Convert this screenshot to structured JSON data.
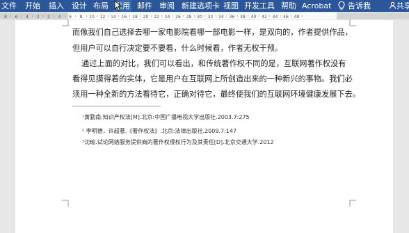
{
  "ribbon": {
    "tabs": [
      "文件",
      "开始",
      "插入",
      "设计",
      "布局",
      "引用",
      "邮件",
      "审阅",
      "新建选项卡",
      "视图",
      "开发工具",
      "帮助",
      "Acrobat"
    ],
    "tell_me": "告诉我",
    "share": "共享",
    "colors": {
      "ribbon_bg": "#2b579a",
      "active_tab": "#3b67aa"
    },
    "icons": [
      "lightbulb-icon",
      "share-icon",
      "mouse-cursor-icon"
    ]
  },
  "ruler": {
    "labels": [
      "8",
      "6",
      "4",
      "2",
      "2",
      "4",
      "6",
      "8",
      "10",
      "12",
      "14",
      "16",
      "18",
      "20",
      "22",
      "24",
      "26",
      "28",
      "30",
      "32",
      "34",
      "36",
      "38",
      "40",
      "42",
      "44",
      "46",
      "48"
    ]
  },
  "document": {
    "paragraphs": [
      "而像我们自己选择去哪一家电影院看哪一部电影一样，是双向的，作者提供作品，",
      "但用户可以自行决定要不要看，什么时候看，作者无权干预。",
      "通过上面的对比，我们可以看出，和传统著作权不同的是，互联网著作权没有",
      "看得见摸得着的实体，它是用户在互联网上所创造出来的一种新兴的事物。我们必",
      "须用一种全新的方法看待它，正确对待它，最终使我们的互联网环境健康发展下去。"
    ],
    "footnotes": [
      "¹黄勤南.知识产权法[M].北京:中国广播电视大学出版社.2003.7:275",
      "² 李明德，许超著.《著作权法》.北京:法律出版社.2009.7:147",
      "³沈瑜.试论网络服务提供商的著作权侵权行为及其责任[D].北京交通大学.2012"
    ]
  }
}
